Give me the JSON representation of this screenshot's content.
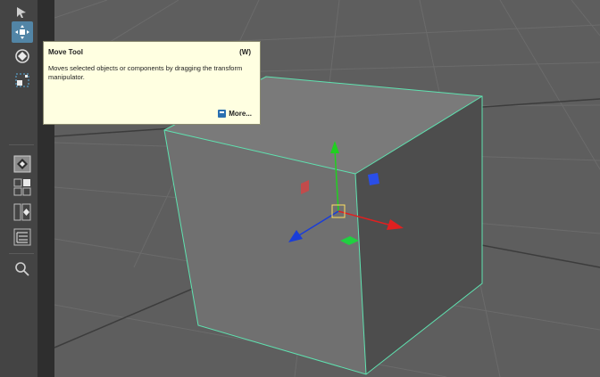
{
  "toolbox": {
    "tools": [
      {
        "name": "select-tool",
        "icon": "arrow-select-icon"
      },
      {
        "name": "move-tool",
        "icon": "move-arrows-icon",
        "active": true
      },
      {
        "name": "rotate-tool",
        "icon": "rotate-icon"
      },
      {
        "name": "scale-tool",
        "icon": "scale-icon"
      }
    ],
    "layout_buttons": [
      {
        "name": "single-perspective-view",
        "icon": "single-view-icon"
      },
      {
        "name": "four-view-layout",
        "icon": "four-view-icon"
      },
      {
        "name": "persp-outliner-layout",
        "icon": "two-pane-icon"
      },
      {
        "name": "outliner-layout",
        "icon": "outliner-icon"
      }
    ],
    "search_icon": "magnifier-icon"
  },
  "tooltip": {
    "title": "Move Tool",
    "hotkey": "(W)",
    "description": "Moves selected objects or components by dragging the transform manipulator.",
    "more_label": "More..."
  },
  "colors": {
    "viewport_bg": "#5e5e5e",
    "grid_line": "#6a6a6a",
    "selection_outline": "#5fe2b0",
    "x_axis": "#e02020",
    "y_axis": "#20d020",
    "z_axis": "#1a3dd8",
    "tooltip_bg": "#ffffe1",
    "active_tool": "#5285a6"
  }
}
